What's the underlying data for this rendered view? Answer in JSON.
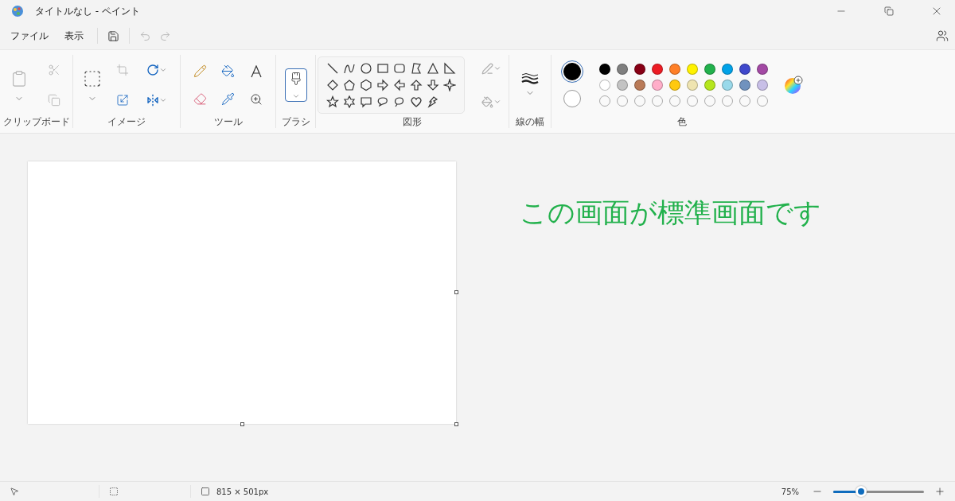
{
  "window": {
    "title": "タイトルなし - ペイント"
  },
  "menu": [
    {
      "label": "ファイル"
    },
    {
      "label": "表示"
    }
  ],
  "quick_access": [
    {
      "kind": "save",
      "disabled": false
    },
    {
      "kind": "undo",
      "disabled": true
    },
    {
      "kind": "redo",
      "disabled": true
    }
  ],
  "ribbon": {
    "groups": [
      {
        "label": "クリップボード"
      },
      {
        "label": "イメージ"
      },
      {
        "label": "ツール"
      },
      {
        "label": "ブラシ"
      },
      {
        "label": "図形"
      },
      {
        "label": "線の幅"
      },
      {
        "label": "色"
      }
    ],
    "brush": {
      "selected": true
    },
    "current_colors": [
      {
        "color": "#000000",
        "selected": true
      },
      {
        "color": "#ffffff",
        "selected": false
      }
    ],
    "palette": [
      {
        "color": "#000000"
      },
      {
        "color": "#7f7f7f"
      },
      {
        "color": "#880015"
      },
      {
        "color": "#ed1c24"
      },
      {
        "color": "#ff7f27"
      },
      {
        "color": "#fff200"
      },
      {
        "color": "#22b14c"
      },
      {
        "color": "#00a2e8"
      },
      {
        "color": "#3f48cc"
      },
      {
        "color": "#a349a4"
      },
      {
        "color": "#ffffff"
      },
      {
        "color": "#c3c3c3"
      },
      {
        "color": "#b97a57"
      },
      {
        "color": "#ffaec9"
      },
      {
        "color": "#ffc90e"
      },
      {
        "color": "#efe4b0"
      },
      {
        "color": "#b5e61d"
      },
      {
        "color": "#99d9ea"
      },
      {
        "color": "#7092be"
      },
      {
        "color": "#c8bfe7"
      }
    ]
  },
  "annotation": {
    "text": "この画面が標準画面です"
  },
  "status_bar": {
    "canvas_size": "815 × 501px",
    "zoom": "75%",
    "zoom_slider": {
      "level": 0.31
    }
  }
}
